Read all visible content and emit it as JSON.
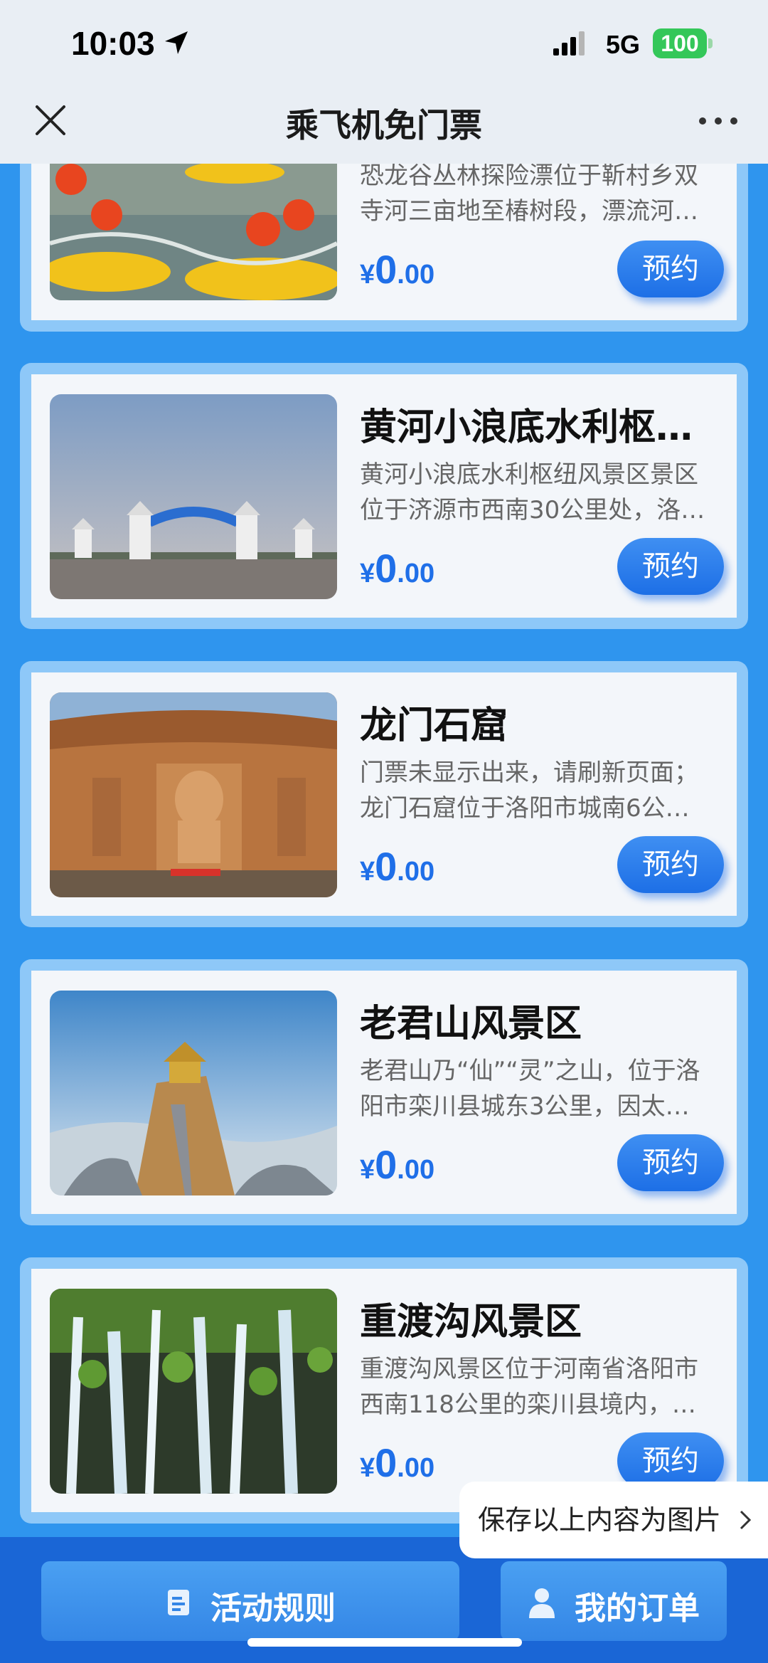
{
  "status": {
    "time": "10:03",
    "network": "5G",
    "battery": "100"
  },
  "nav": {
    "title": "乘飞机免门票"
  },
  "cards": [
    {
      "title": "",
      "desc1": "恐龙谷丛林探险漂位于靳村乡双",
      "desc2": "寺河三亩地至椿树段，漂流河…",
      "yen": "¥",
      "price_int": "0",
      "price_dec": ".00",
      "button": "预约"
    },
    {
      "title": "黄河小浪底水利枢…",
      "desc1": "黄河小浪底水利枢纽风景区景区",
      "desc2": "位于济源市西南30公里处，洛…",
      "yen": "¥",
      "price_int": "0",
      "price_dec": ".00",
      "button": "预约"
    },
    {
      "title": "龙门石窟",
      "desc1": "门票未显示出来，请刷新页面；",
      "desc2": "龙门石窟位于洛阳市城南6公…",
      "yen": "¥",
      "price_int": "0",
      "price_dec": ".00",
      "button": "预约"
    },
    {
      "title": "老君山风景区",
      "desc1": "老君山乃“仙”“灵”之山，位于洛",
      "desc2": "阳市栾川县城东3公里，因太…",
      "yen": "¥",
      "price_int": "0",
      "price_dec": ".00",
      "button": "预约"
    },
    {
      "title": "重渡沟风景区",
      "desc1": "重渡沟风景区位于河南省洛阳市",
      "desc2": "西南118公里的栾川县境内，…",
      "yen": "¥",
      "price_int": "0",
      "price_dec": ".00",
      "button": "预约"
    }
  ],
  "save_tip": "保存以上内容为图片",
  "bottom": {
    "rules": "活动规则",
    "orders": "我的订单"
  },
  "colors": {
    "accent": "#1f6fe8",
    "background": "#2f95ee",
    "bottom_bar": "#1a66d6"
  }
}
